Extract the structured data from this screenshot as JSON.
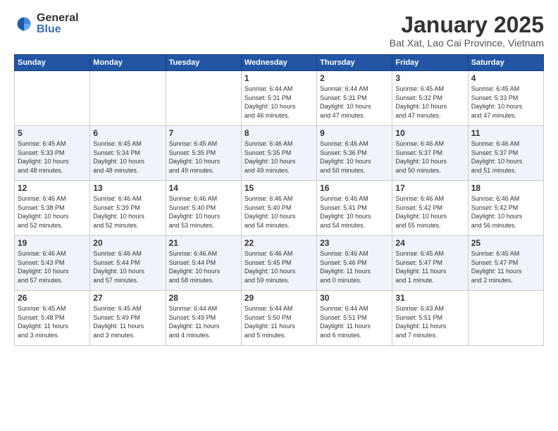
{
  "logo": {
    "general": "General",
    "blue": "Blue"
  },
  "header": {
    "month": "January 2025",
    "location": "Bat Xat, Lao Cai Province, Vietnam"
  },
  "weekdays": [
    "Sunday",
    "Monday",
    "Tuesday",
    "Wednesday",
    "Thursday",
    "Friday",
    "Saturday"
  ],
  "weeks": [
    [
      {
        "day": "",
        "info": ""
      },
      {
        "day": "",
        "info": ""
      },
      {
        "day": "",
        "info": ""
      },
      {
        "day": "1",
        "info": "Sunrise: 6:44 AM\nSunset: 5:31 PM\nDaylight: 10 hours\nand 46 minutes."
      },
      {
        "day": "2",
        "info": "Sunrise: 6:44 AM\nSunset: 5:31 PM\nDaylight: 10 hours\nand 47 minutes."
      },
      {
        "day": "3",
        "info": "Sunrise: 6:45 AM\nSunset: 5:32 PM\nDaylight: 10 hours\nand 47 minutes."
      },
      {
        "day": "4",
        "info": "Sunrise: 6:45 AM\nSunset: 5:33 PM\nDaylight: 10 hours\nand 47 minutes."
      }
    ],
    [
      {
        "day": "5",
        "info": "Sunrise: 6:45 AM\nSunset: 5:33 PM\nDaylight: 10 hours\nand 48 minutes."
      },
      {
        "day": "6",
        "info": "Sunrise: 6:45 AM\nSunset: 5:34 PM\nDaylight: 10 hours\nand 48 minutes."
      },
      {
        "day": "7",
        "info": "Sunrise: 6:45 AM\nSunset: 5:35 PM\nDaylight: 10 hours\nand 49 minutes."
      },
      {
        "day": "8",
        "info": "Sunrise: 6:46 AM\nSunset: 5:35 PM\nDaylight: 10 hours\nand 49 minutes."
      },
      {
        "day": "9",
        "info": "Sunrise: 6:46 AM\nSunset: 5:36 PM\nDaylight: 10 hours\nand 50 minutes."
      },
      {
        "day": "10",
        "info": "Sunrise: 6:46 AM\nSunset: 5:37 PM\nDaylight: 10 hours\nand 50 minutes."
      },
      {
        "day": "11",
        "info": "Sunrise: 6:46 AM\nSunset: 5:37 PM\nDaylight: 10 hours\nand 51 minutes."
      }
    ],
    [
      {
        "day": "12",
        "info": "Sunrise: 6:46 AM\nSunset: 5:38 PM\nDaylight: 10 hours\nand 52 minutes."
      },
      {
        "day": "13",
        "info": "Sunrise: 6:46 AM\nSunset: 5:39 PM\nDaylight: 10 hours\nand 52 minutes."
      },
      {
        "day": "14",
        "info": "Sunrise: 6:46 AM\nSunset: 5:40 PM\nDaylight: 10 hours\nand 53 minutes."
      },
      {
        "day": "15",
        "info": "Sunrise: 6:46 AM\nSunset: 5:40 PM\nDaylight: 10 hours\nand 54 minutes."
      },
      {
        "day": "16",
        "info": "Sunrise: 6:46 AM\nSunset: 5:41 PM\nDaylight: 10 hours\nand 54 minutes."
      },
      {
        "day": "17",
        "info": "Sunrise: 6:46 AM\nSunset: 5:42 PM\nDaylight: 10 hours\nand 55 minutes."
      },
      {
        "day": "18",
        "info": "Sunrise: 6:46 AM\nSunset: 5:42 PM\nDaylight: 10 hours\nand 56 minutes."
      }
    ],
    [
      {
        "day": "19",
        "info": "Sunrise: 6:46 AM\nSunset: 5:43 PM\nDaylight: 10 hours\nand 57 minutes."
      },
      {
        "day": "20",
        "info": "Sunrise: 6:46 AM\nSunset: 5:44 PM\nDaylight: 10 hours\nand 57 minutes."
      },
      {
        "day": "21",
        "info": "Sunrise: 6:46 AM\nSunset: 5:44 PM\nDaylight: 10 hours\nand 58 minutes."
      },
      {
        "day": "22",
        "info": "Sunrise: 6:46 AM\nSunset: 5:45 PM\nDaylight: 10 hours\nand 59 minutes."
      },
      {
        "day": "23",
        "info": "Sunrise: 6:46 AM\nSunset: 5:46 PM\nDaylight: 11 hours\nand 0 minutes."
      },
      {
        "day": "24",
        "info": "Sunrise: 6:45 AM\nSunset: 5:47 PM\nDaylight: 11 hours\nand 1 minute."
      },
      {
        "day": "25",
        "info": "Sunrise: 6:45 AM\nSunset: 5:47 PM\nDaylight: 11 hours\nand 2 minutes."
      }
    ],
    [
      {
        "day": "26",
        "info": "Sunrise: 6:45 AM\nSunset: 5:48 PM\nDaylight: 11 hours\nand 3 minutes."
      },
      {
        "day": "27",
        "info": "Sunrise: 6:45 AM\nSunset: 5:49 PM\nDaylight: 11 hours\nand 3 minutes."
      },
      {
        "day": "28",
        "info": "Sunrise: 6:44 AM\nSunset: 5:49 PM\nDaylight: 11 hours\nand 4 minutes."
      },
      {
        "day": "29",
        "info": "Sunrise: 6:44 AM\nSunset: 5:50 PM\nDaylight: 11 hours\nand 5 minutes."
      },
      {
        "day": "30",
        "info": "Sunrise: 6:44 AM\nSunset: 5:51 PM\nDaylight: 11 hours\nand 6 minutes."
      },
      {
        "day": "31",
        "info": "Sunrise: 6:43 AM\nSunset: 5:51 PM\nDaylight: 11 hours\nand 7 minutes."
      },
      {
        "day": "",
        "info": ""
      }
    ]
  ]
}
